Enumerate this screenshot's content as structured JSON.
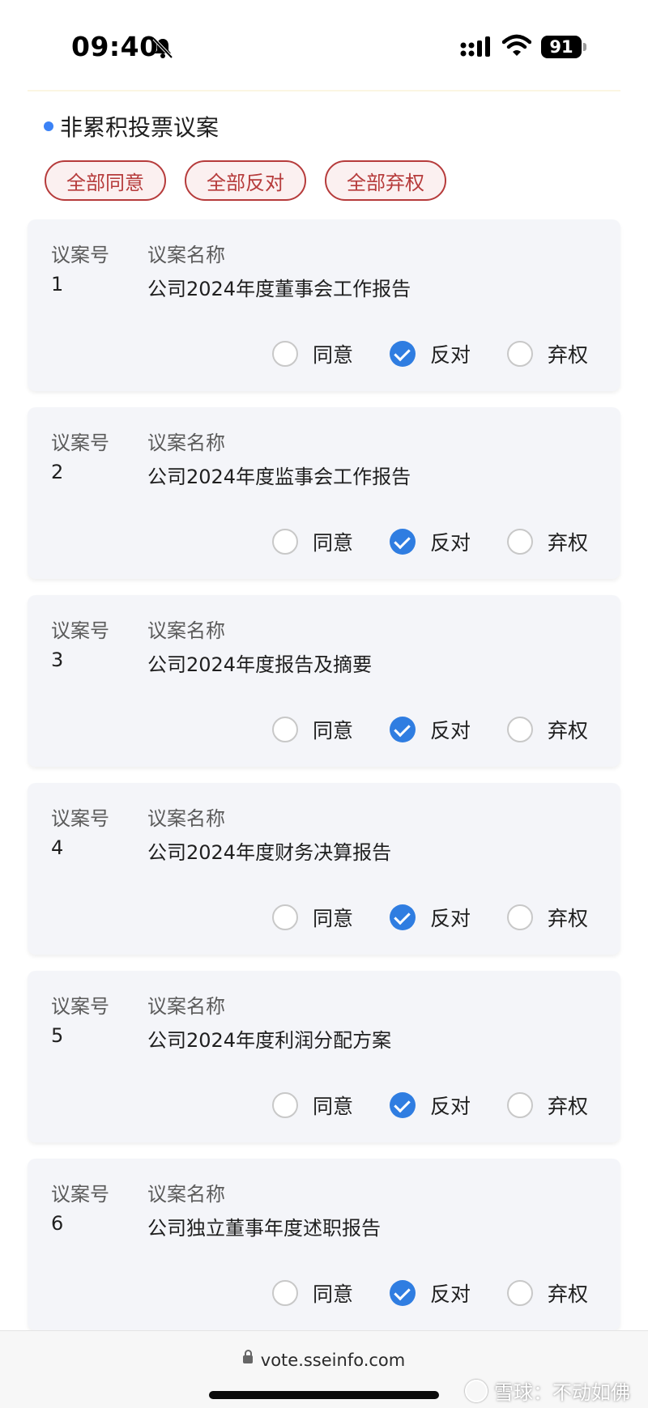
{
  "status_bar": {
    "time": "09:40",
    "battery": "91",
    "icons": [
      "bell-mute-icon",
      "signal-icon",
      "wifi-icon",
      "battery-icon"
    ]
  },
  "section": {
    "title": "非累积投票议案"
  },
  "bulk_actions": {
    "agree_all": "全部同意",
    "oppose_all": "全部反对",
    "abstain_all": "全部弃权"
  },
  "labels": {
    "no_header": "议案号",
    "name_header": "议案名称",
    "agree": "同意",
    "oppose": "反对",
    "abstain": "弃权"
  },
  "proposals": [
    {
      "no": "1",
      "name": "公司2024年度董事会工作报告",
      "selected": "oppose"
    },
    {
      "no": "2",
      "name": "公司2024年度监事会工作报告",
      "selected": "oppose"
    },
    {
      "no": "3",
      "name": "公司2024年度报告及摘要",
      "selected": "oppose"
    },
    {
      "no": "4",
      "name": "公司2024年度财务决算报告",
      "selected": "oppose"
    },
    {
      "no": "5",
      "name": "公司2024年度利润分配方案",
      "selected": "oppose"
    },
    {
      "no": "6",
      "name": "公司独立董事年度述职报告",
      "selected": "oppose"
    }
  ],
  "bottom_bar": {
    "url": "vote.sseinfo.com",
    "watermark": "雪球：不动如佛"
  },
  "colors": {
    "accent_blue": "#2f7de1",
    "bulk_red": "#b63b3b",
    "card_bg": "#f4f5f9"
  }
}
